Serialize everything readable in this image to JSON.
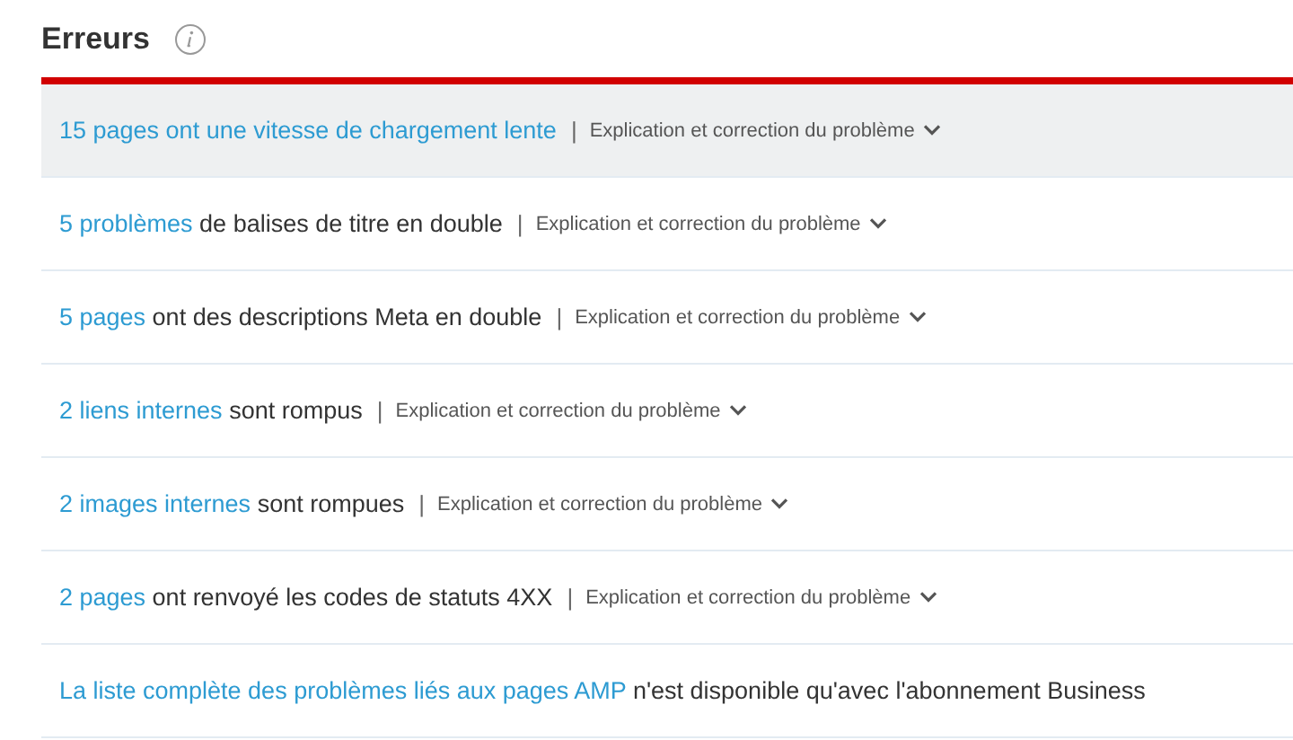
{
  "title": "Erreurs",
  "rows": [
    {
      "link": "15 pages ont une vitesse de chargement lente",
      "separator": "|",
      "help": "Explication et correction du problème",
      "highlighted": true
    },
    {
      "link": "5 problèmes",
      "text": "de balises de titre en double",
      "separator": "|",
      "help": "Explication et correction du problème",
      "highlighted": false
    },
    {
      "link": "5 pages",
      "text": "ont des descriptions Meta en double",
      "separator": "|",
      "help": "Explication et correction du problème",
      "highlighted": false
    },
    {
      "link": "2 liens internes",
      "text": "sont rompus",
      "separator": "|",
      "help": "Explication et correction du problème",
      "highlighted": false
    },
    {
      "link": "2 images internes",
      "text": "sont rompues",
      "separator": "|",
      "help": "Explication et correction du problème",
      "highlighted": false
    },
    {
      "link": "2 pages",
      "text": "ont renvoyé les codes de statuts 4XX",
      "separator": "|",
      "help": "Explication et correction du problème",
      "highlighted": false
    },
    {
      "link": "La liste complète des problèmes liés aux pages AMP",
      "text": "n'est disponible qu'avec l'abonnement Business",
      "highlighted": false
    }
  ]
}
